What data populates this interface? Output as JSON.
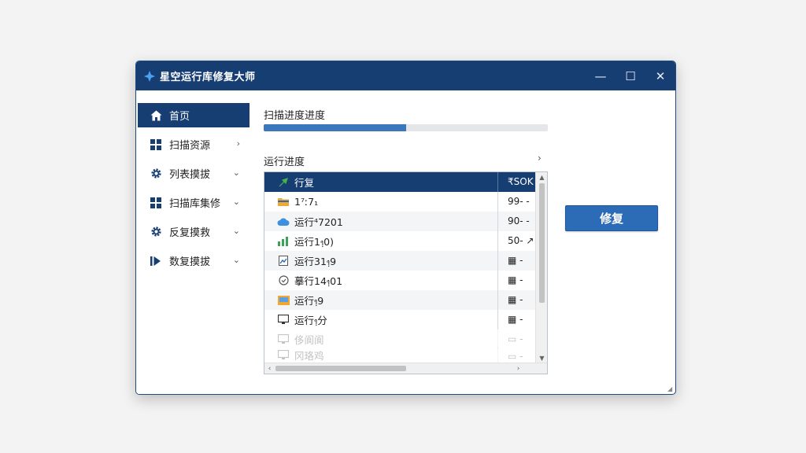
{
  "window": {
    "title": "星空运行库修复大师",
    "controls": {
      "minimize": "—",
      "maximize": "☐",
      "close": "✕"
    }
  },
  "sidebar": {
    "items": [
      {
        "label": "首页",
        "icon": "home-icon",
        "active": true,
        "chevron": ""
      },
      {
        "label": "扫描资源",
        "icon": "grid-icon",
        "active": false,
        "chevron": "›"
      },
      {
        "label": "列表摸拔",
        "icon": "gear-icon",
        "active": false,
        "chevron": "⌄"
      },
      {
        "label": "扫描库集修",
        "icon": "grid-icon",
        "active": false,
        "chevron": "⌄"
      },
      {
        "label": "反复摸救",
        "icon": "gear-icon",
        "active": false,
        "chevron": "⌄"
      },
      {
        "label": "数复摸拔",
        "icon": "play-bar-icon",
        "active": false,
        "chevron": "⌄"
      }
    ]
  },
  "main": {
    "scan_progress_label": "扫描进度进度",
    "scan_progress_fraction": 0.5,
    "run_progress_label": "运行进度",
    "run_progress_chevron": "›",
    "list": {
      "rows": [
        {
          "name": "行复",
          "value": "₹SOK",
          "icon": "arrow-up-icon",
          "selected": true
        },
        {
          "name": "1⁷ː7₁",
          "value": "99- -",
          "icon": "folder-icon",
          "selected": false
        },
        {
          "name": "运行⁴7201",
          "value": "90- -",
          "icon": "cloud-icon",
          "selected": false
        },
        {
          "name": "运行1᥄0)",
          "value": "50- ↗",
          "icon": "bar-chart-icon",
          "selected": false
        },
        {
          "name": "运行31᥄9",
          "value": "▦ -",
          "icon": "image-file-icon",
          "selected": false
        },
        {
          "name": "摹行14᥄01",
          "value": "▦ -",
          "icon": "shield-icon",
          "selected": false
        },
        {
          "name": "运行᥄9",
          "value": "▦ -",
          "icon": "folder-open-icon",
          "selected": false
        },
        {
          "name": "运行᥄分",
          "value": "▦ -",
          "icon": "monitor-icon",
          "selected": false
        },
        {
          "name": "侈阆阆",
          "value": "▭ -",
          "icon": "monitor-icon",
          "selected": false
        },
        {
          "name": "冈珞鸡",
          "value": "▭ -",
          "icon": "monitor-icon",
          "selected": false
        }
      ]
    },
    "repair_button_label": "修复"
  },
  "colors": {
    "titlebar": "#173e73",
    "accent": "#2c6bb5",
    "progress": "#3b77bd"
  }
}
